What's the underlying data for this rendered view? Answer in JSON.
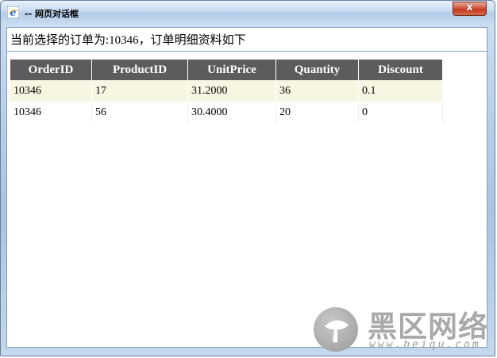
{
  "window": {
    "title": "-- 网页对话框",
    "close_label": "x"
  },
  "page": {
    "heading": "当前选择的订单为:10346，订单明细资料如下"
  },
  "table": {
    "columns": [
      "OrderID",
      "ProductID",
      "UnitPrice",
      "Quantity",
      "Discount"
    ],
    "rows": [
      [
        "10346",
        "17",
        "31.2000",
        "36",
        "0.1"
      ],
      [
        "10346",
        "56",
        "30.4000",
        "20",
        "0"
      ]
    ]
  },
  "watermark": {
    "text": "黑区网络",
    "url": "www.heiqu.com"
  },
  "colors": {
    "header_bg": "#5d5b5e",
    "odd_row_bg": "#f7f6e2",
    "close_button": "#c0381f"
  }
}
